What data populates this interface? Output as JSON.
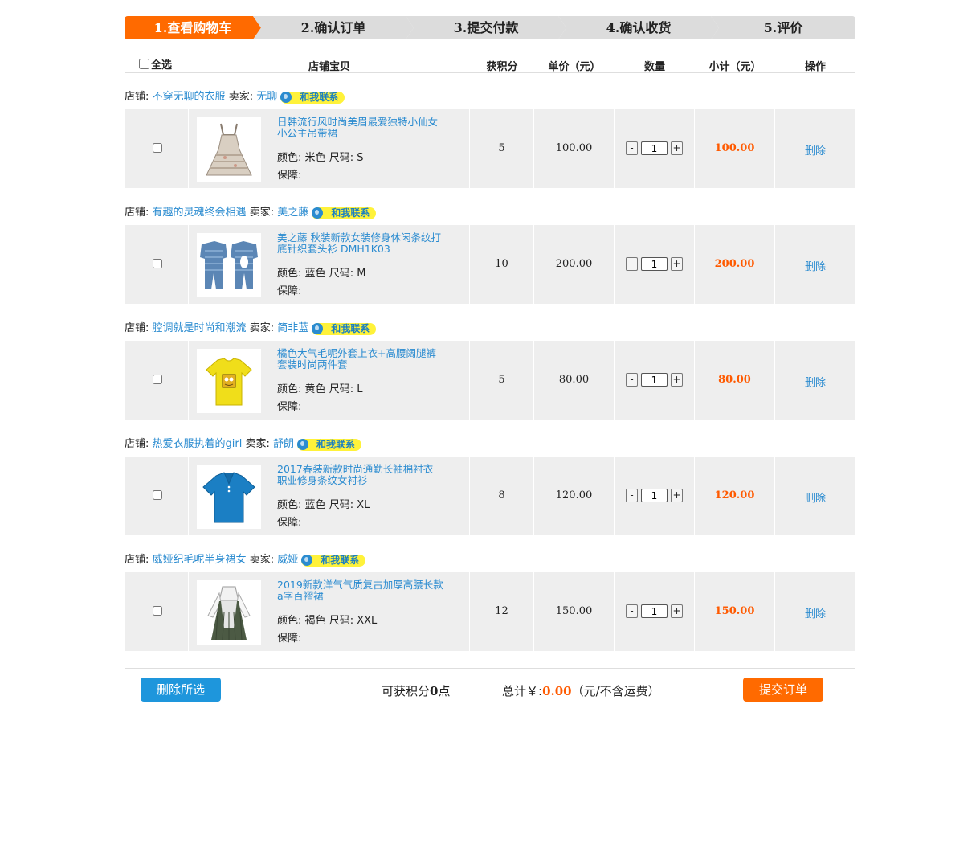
{
  "steps": [
    "1.查看购物车",
    "2.确认订单",
    "3.提交付款",
    "4.确认收货",
    "5.评价"
  ],
  "active_step": 0,
  "table_header": {
    "select_all": "全选",
    "item": "店铺宝贝",
    "points": "获积分",
    "unit_price": "单价（元）",
    "quantity": "数量",
    "subtotal": "小计（元）",
    "action": "操作"
  },
  "labels": {
    "shop": "店铺:",
    "seller": "卖家:",
    "contact": "和我联系",
    "color": "颜色:",
    "size": "尺码:",
    "warranty": "保障:",
    "delete": "删除",
    "minus": "-",
    "plus": "+"
  },
  "orders": [
    {
      "shop_name": "不穿无聊的衣服",
      "seller_name": "无聊",
      "title": "日韩流行风时尚美眉最爱独特小仙女小公主吊带裙",
      "color": "米色",
      "size": "S",
      "points": "5",
      "price": "100.00",
      "qty": "1",
      "subtotal": "100.00",
      "thumb_icon": "slip-dress-image"
    },
    {
      "shop_name": "有趣的灵魂终会相遇",
      "seller_name": "美之藤",
      "title": "美之藤 秋装新款女装修身休闲条纹打底针织套头衫 DMH1K03",
      "color": "蓝色",
      "size": "M",
      "points": "10",
      "price": "200.00",
      "qty": "1",
      "subtotal": "200.00",
      "thumb_icon": "striped-romper-image"
    },
    {
      "shop_name": "腔调就是时尚和潮流",
      "seller_name": "简非蓝",
      "title": "橘色大气毛呢外套上衣+高腰阔腿裤套装时尚两件套",
      "color": "黄色",
      "size": "L",
      "points": "5",
      "price": "80.00",
      "qty": "1",
      "subtotal": "80.00",
      "thumb_icon": "yellow-tshirt-image"
    },
    {
      "shop_name": "热爱衣服执着的girl",
      "seller_name": "舒朗",
      "title": "2017春装新款时尚通勤长袖棉衬衣 职业修身条纹女衬衫",
      "color": "蓝色",
      "size": "XL",
      "points": "8",
      "price": "120.00",
      "qty": "1",
      "subtotal": "120.00",
      "thumb_icon": "blue-polo-image"
    },
    {
      "shop_name": "威娅纪毛呢半身裙女",
      "seller_name": "威娅",
      "title": "2019新款洋气气质复古加厚高腰长款a字百褶裙",
      "color": "褐色",
      "size": "XXL",
      "points": "12",
      "price": "150.00",
      "qty": "1",
      "subtotal": "150.00",
      "thumb_icon": "hanfu-dress-image"
    }
  ],
  "footer": {
    "delete_selected": "删除所选",
    "points_prefix": "可获积分",
    "points_value": "0",
    "points_suffix": "点",
    "total_prefix": "总计￥:",
    "total_value": "0.00",
    "total_suffix": "（元/不含运费）",
    "submit": "提交订单"
  },
  "colors": {
    "accent_orange": "#ff6a00",
    "link_blue": "#2a8bd0",
    "button_blue": "#1e96dc",
    "price_red": "#ff5a00",
    "contact_yellow": "#fff23a"
  }
}
